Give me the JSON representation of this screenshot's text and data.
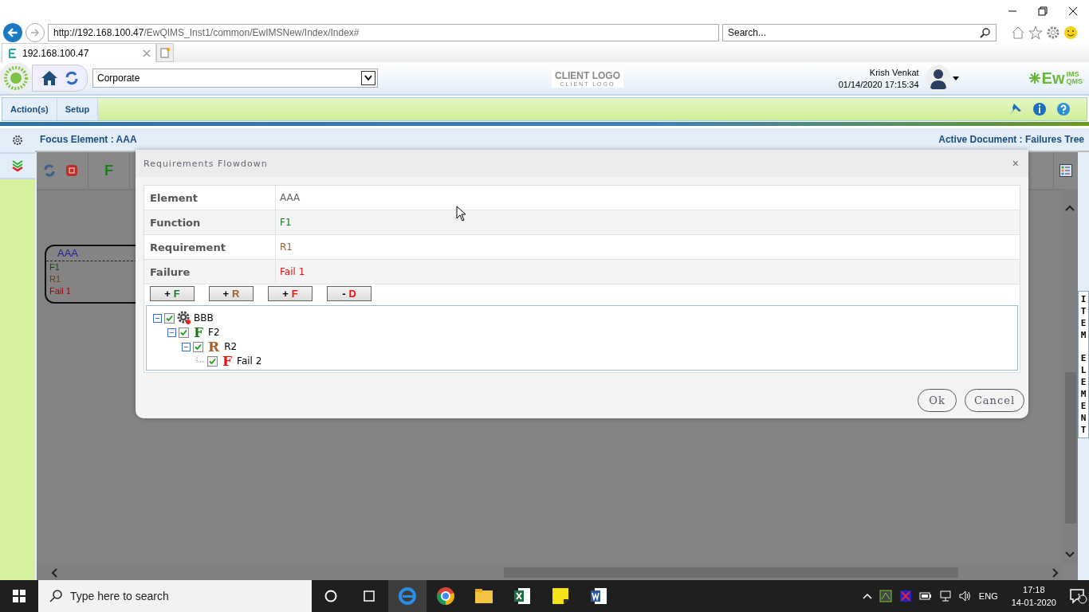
{
  "browser": {
    "url_host": "http://192.168.100.47",
    "url_path": "/EwQIMS_Inst1/common/EwIMSNew/Index/Index#",
    "search_placeholder": "Search...",
    "tab_title": "192.168.100.47"
  },
  "header": {
    "org_select": "Corporate",
    "client_logo": "CLIENT LOGO",
    "client_logo_sub": "CLIENT LOGO",
    "user": "Krish Venkat",
    "datetime": "01/14/2020 17:15:34",
    "brand": "Ew",
    "brand_top": "IMS",
    "brand_bottom": "QMS"
  },
  "menu": [
    {
      "label": "Action(s)"
    },
    {
      "label": "Setup"
    }
  ],
  "focus_bar": {
    "focus": "Focus Element : AAA",
    "active_document": "Active Document : Failures Tree"
  },
  "toolbar": [
    {
      "glyph": "F",
      "kind": "function"
    }
  ],
  "node": {
    "title": "AAA",
    "lines": [
      {
        "text": "F1",
        "kind": "function"
      },
      {
        "text": "R1",
        "kind": "requirement"
      },
      {
        "text": "Fail 1",
        "kind": "failure"
      }
    ]
  },
  "dialog": {
    "title": "Requirements Flowdown",
    "close": "×",
    "fields": [
      {
        "label": "Element",
        "value": "AAA",
        "kind": "element"
      },
      {
        "label": "Function",
        "value": "F1",
        "kind": "function"
      },
      {
        "label": "Requirement",
        "value": "R1",
        "kind": "requirement"
      },
      {
        "label": "Failure",
        "value": "Fail 1",
        "kind": "failure"
      }
    ],
    "add_buttons": [
      {
        "sign": "+",
        "letter": "F",
        "kind": "function"
      },
      {
        "sign": "+",
        "letter": "R",
        "kind": "requirement"
      },
      {
        "sign": "+",
        "letter": "F",
        "kind": "failure"
      },
      {
        "sign": "-",
        "letter": "D",
        "kind": "failure"
      }
    ],
    "tree": [
      {
        "label": "BBB",
        "kind": "element",
        "checked": true,
        "expanded": true,
        "children": [
          {
            "label": "F2",
            "kind": "function",
            "glyph": "F",
            "checked": true,
            "expanded": true,
            "children": [
              {
                "label": "R2",
                "kind": "requirement",
                "glyph": "R",
                "checked": true,
                "expanded": true,
                "children": [
                  {
                    "label": "Fail 2",
                    "kind": "failure",
                    "glyph": "F",
                    "checked": true
                  }
                ]
              }
            ]
          }
        ]
      }
    ],
    "buttons": [
      "Ok",
      "Cancel"
    ]
  },
  "side_tab": [
    "ITEM",
    "ELEMENT"
  ],
  "taskbar": {
    "search_placeholder": "Type here to search",
    "language": "ENG",
    "time": "17:18",
    "date": "14-01-2020",
    "notifications": "1"
  }
}
